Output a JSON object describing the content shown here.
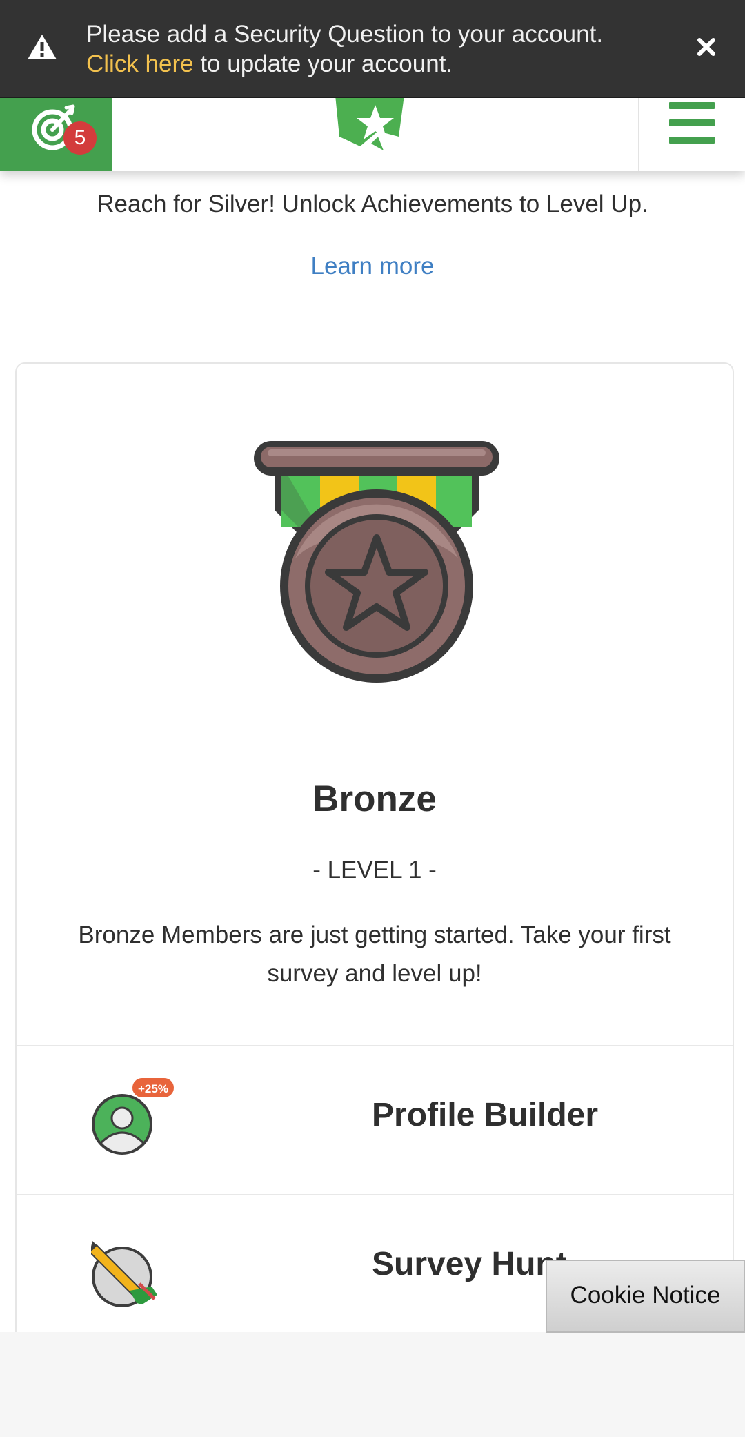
{
  "alert": {
    "message": "Please add a Security Question to your account.",
    "link_text": "Click here",
    "link_suffix": " to update your account.",
    "icon": "warning-icon",
    "close_icon": "close-icon"
  },
  "header": {
    "goals_badge_count": "5",
    "goals_icon": "target-icon",
    "logo": "star-logo",
    "menu_icon": "hamburger-menu-icon",
    "brand_color": "#44a04e"
  },
  "intro": {
    "promo_text": "Reach for Silver! Unlock Achievements to Level Up.",
    "learn_more": "Learn more",
    "link_color": "#3f7fc3"
  },
  "level_card": {
    "medal_icon": "bronze-medal-icon",
    "level_name": "Bronze",
    "level_number": "- LEVEL 1 -",
    "description": "Bronze Members are just getting started. Take your first survey and level up!",
    "achievements": [
      {
        "label": "Profile Builder",
        "icon": "profile-avatar-icon",
        "badge": "+25%"
      },
      {
        "label": "Survey Hunt",
        "icon": "pencil-arrow-icon"
      }
    ]
  },
  "cookie": {
    "label": "Cookie Notice"
  }
}
